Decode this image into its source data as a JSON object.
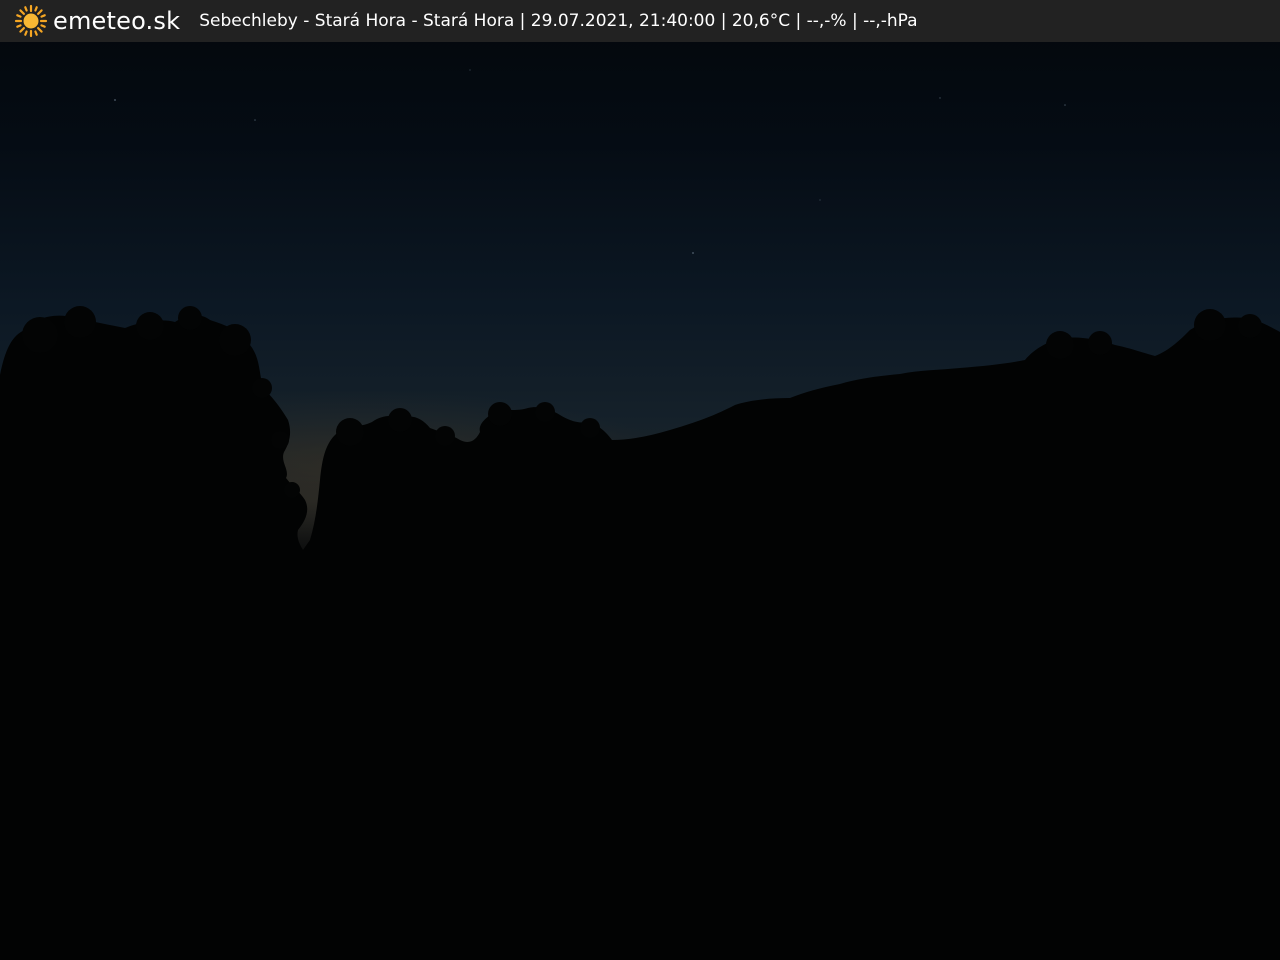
{
  "header": {
    "logo_icon": "sun-icon",
    "brand": "emeteo.sk",
    "caption": "Sebechleby - Stará Hora - Stará Hora | 29.07.2021, 21:40:00 | 20,6°C | --,-% | --,-hPa"
  },
  "colors": {
    "bar_background": "#222222",
    "sun": "#f5a623",
    "sky_top": "#06101a",
    "sky_horizon": "#13202a"
  }
}
